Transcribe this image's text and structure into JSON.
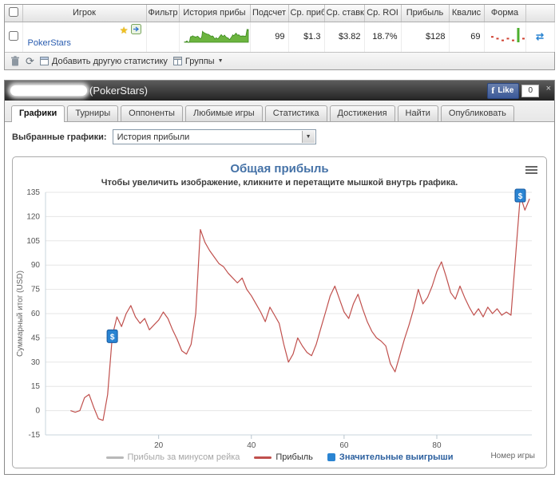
{
  "icons": {
    "caret_down": "▼",
    "refresh": "⟳",
    "close": "×",
    "double_arrow": "⇄",
    "star": "★"
  },
  "watchlist": {
    "headers": [
      "Игрок",
      "Фильтр",
      "История прибы",
      "Подсчет",
      "Ср. приб",
      "Ср. ставк",
      "Ср. ROI",
      "Прибыль",
      "Квалис",
      "Форма"
    ],
    "row": {
      "player": "PokerStars",
      "count": "99",
      "avg_profit": "$1.3",
      "avg_stake": "$3.82",
      "avg_roi": "18.7%",
      "profit": "$128",
      "qualifies": "69"
    },
    "footer": {
      "add_stat_label": "Добавить другую статистику",
      "groups_label": "Группы"
    },
    "sparkline": {
      "fill": "#6cb43f",
      "stroke": "#3c8a1e"
    },
    "form_chart": {
      "values": [
        -1,
        -2,
        -3,
        -2,
        -3,
        12,
        -2
      ],
      "positive_color": "#4caf2e",
      "negative_color": "#d04030"
    }
  },
  "profile": {
    "title": "(PokerStars)",
    "fb": {
      "f": "f",
      "like": "Like",
      "count": "0"
    },
    "tabs": [
      {
        "label": "Графики",
        "active": true
      },
      {
        "label": "Турниры",
        "active": false
      },
      {
        "label": "Оппоненты",
        "active": false
      },
      {
        "label": "Любимые игры",
        "active": false
      },
      {
        "label": "Статистика",
        "active": false
      },
      {
        "label": "Достижения",
        "active": false
      },
      {
        "label": "Найти",
        "active": false
      },
      {
        "label": "Опубликовать",
        "active": false
      }
    ],
    "chart_select_label": "Выбранные графики:",
    "chart_select_value": "История прибыли"
  },
  "chart_data": {
    "type": "line",
    "title": "Общая прибыль",
    "subtitle": "Чтобы увеличить изображение, кликните и перетащите мышкой внутрь графика.",
    "ylabel": "Суммарный итог (USD)",
    "xlabel": "Номер игры",
    "ylim": [
      -15,
      135
    ],
    "yticks": [
      -15,
      0,
      15,
      30,
      45,
      60,
      75,
      90,
      105,
      120,
      135
    ],
    "xlim": [
      -4.4,
      100.5
    ],
    "xticks": [
      20,
      40,
      60,
      80
    ],
    "grid": "horizontal",
    "legend_position": "bottom",
    "legend": [
      {
        "label": "Прибыль за минусом рейка",
        "color": "#b8b8b8",
        "style": "line",
        "text_color": "#a6a6a6",
        "bold": false
      },
      {
        "label": "Прибыль",
        "color": "#c0504d",
        "style": "line",
        "text_color": "#333333",
        "bold": false
      },
      {
        "label": "Значительные выигрыши",
        "color": "#2a84d2",
        "style": "square",
        "text_color": "#2b5f9e",
        "bold": true
      }
    ],
    "series": [
      {
        "name": "Прибыль",
        "color": "#c0504d",
        "x_start": 1,
        "x_step": 1,
        "y": [
          0,
          -1,
          0,
          8,
          10,
          2,
          -5,
          -6,
          10,
          46,
          58,
          52,
          60,
          65,
          58,
          54,
          57,
          50,
          53,
          56,
          61,
          57,
          50,
          44,
          37,
          35,
          41,
          60,
          112,
          104,
          99,
          95,
          91,
          89,
          85,
          82,
          79,
          82,
          75,
          71,
          66,
          61,
          55,
          64,
          59,
          54,
          41,
          30,
          35,
          45,
          40,
          36,
          34,
          41,
          51,
          61,
          71,
          77,
          69,
          61,
          57,
          66,
          72,
          63,
          55,
          49,
          45,
          43,
          40,
          29,
          24,
          34,
          44,
          53,
          63,
          75,
          66,
          70,
          77,
          86,
          92,
          83,
          73,
          69,
          77,
          70,
          64,
          59,
          63,
          58,
          64,
          60,
          63,
          59,
          61,
          59,
          96,
          133,
          124,
          131
        ]
      }
    ],
    "markers": {
      "label": "$",
      "color": "#2a84d2",
      "border": "#16589f",
      "points": [
        {
          "x": 10,
          "y": 46
        },
        {
          "x": 98,
          "y": 133
        }
      ]
    }
  }
}
